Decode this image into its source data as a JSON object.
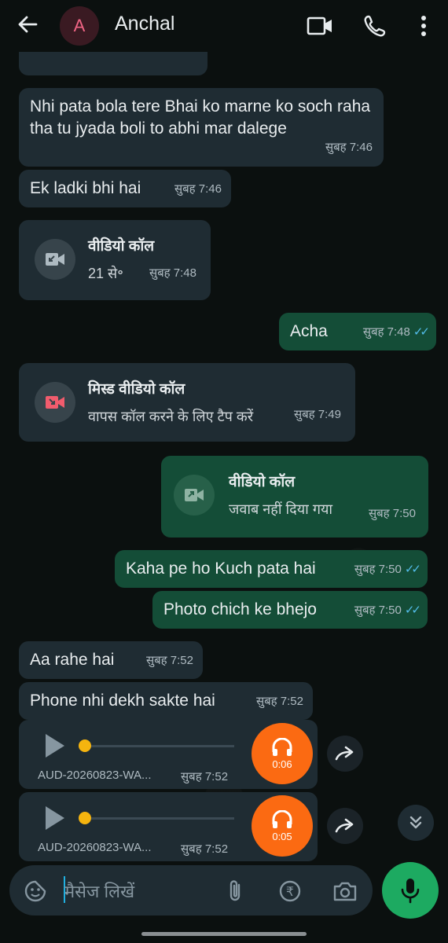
{
  "header": {
    "avatar_letter": "A",
    "contact_name": "Anchal"
  },
  "messages": {
    "m1": {
      "text": "Nhi pata bola tere Bhai ko marne ko soch raha tha tu jyada boli to abhi mar dalege",
      "time": "सुबह 7:46"
    },
    "m2": {
      "text": "Ek ladki bhi hai",
      "time": "सुबह 7:46"
    },
    "m3": {
      "title": "वीडियो कॉल",
      "sub": "21 से॰",
      "time": "सुबह 7:48"
    },
    "m4": {
      "text": "Acha",
      "time": "सुबह 7:48"
    },
    "m5": {
      "title": "मिस्ड वीडियो कॉल",
      "sub": "वापस कॉल करने के लिए टैप करें",
      "time": "सुबह 7:49"
    },
    "m6": {
      "title": "वीडियो कॉल",
      "sub": "जवाब नहीं दिया गया",
      "time": "सुबह 7:50"
    },
    "m7": {
      "text": "Kaha pe ho Kuch pata hai",
      "time": "सुबह 7:50"
    },
    "m8": {
      "text": "Photo chich ke bhejo",
      "time": "सुबह 7:50"
    },
    "m9": {
      "text": "Aa rahe hai",
      "time": "सुबह 7:52"
    },
    "m10": {
      "text": "Phone nhi dekh sakte hai",
      "time": "सुबह 7:52"
    },
    "a1": {
      "filename": "AUD-20260823-WA...",
      "time": "सुबह 7:52",
      "duration": "0:06"
    },
    "a2": {
      "filename": "AUD-20260823-WA...",
      "time": "सुबह 7:52",
      "duration": "0:05"
    }
  },
  "composer": {
    "placeholder": "मैसेज लिखें"
  },
  "colors": {
    "incoming": "#1f2c33",
    "outgoing": "#144d37",
    "missed_call": "#f15c6d",
    "audio_accent": "#fb6a12",
    "mic_button": "#1daa61",
    "read_ticks": "#53bdeb"
  }
}
